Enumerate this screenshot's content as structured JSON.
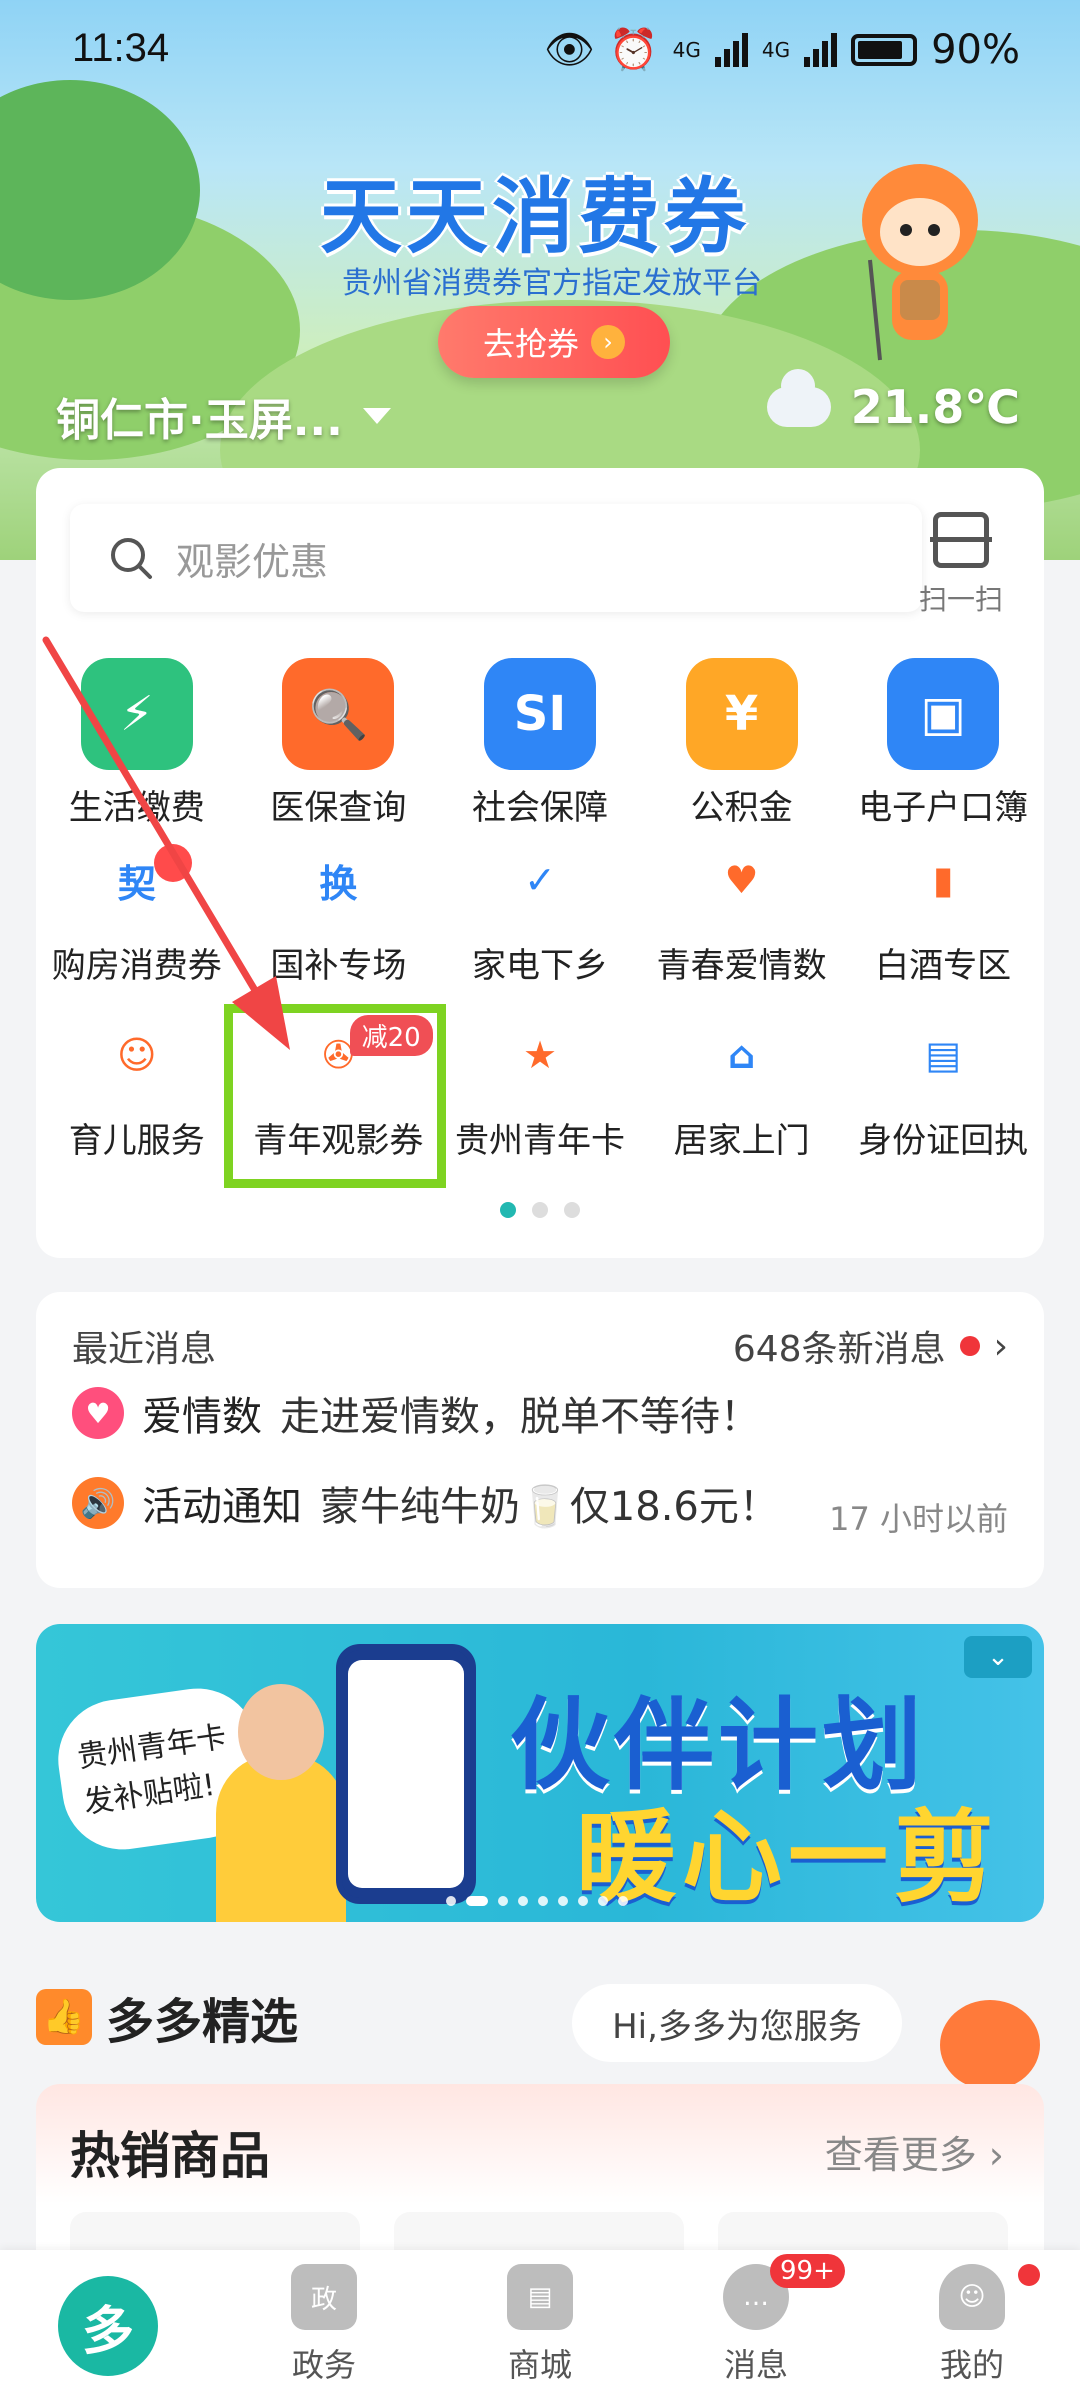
{
  "status_bar": {
    "time": "11:34",
    "battery": "90%",
    "net1": "4G",
    "net2": "4G"
  },
  "header": {
    "banner_title": "天天消费券",
    "banner_subtitle": "贵州省消费券官方指定发放平台",
    "grab_button": "去抢券",
    "location": "铜仁市·玉屏...",
    "temperature": "21.8℃"
  },
  "search": {
    "placeholder": "观影优惠",
    "scan_label": "扫一扫"
  },
  "services": {
    "row1": [
      {
        "label": "生活缴费",
        "icon": "lightning-icon",
        "color": "#2ec27e"
      },
      {
        "label": "医保查询",
        "icon": "search-card-icon",
        "color": "#ff6a2b"
      },
      {
        "label": "社会保障",
        "icon": "si-icon",
        "color": "#2f86f6",
        "icon_text": "SI"
      },
      {
        "label": "公积金",
        "icon": "house-yen-icon",
        "color": "#ffa726",
        "icon_text": "¥"
      },
      {
        "label": "电子户口簿",
        "icon": "id-book-icon",
        "color": "#2f86f6"
      }
    ],
    "row2": [
      {
        "label": "购房消费券",
        "icon": "house-contract-icon",
        "color": "#2f86f6",
        "icon_text": "契"
      },
      {
        "label": "国补专场",
        "icon": "camera-exchange-icon",
        "color": "#2f86f6",
        "icon_text": "换"
      },
      {
        "label": "家电下乡",
        "icon": "house-check-icon",
        "color": "#2f86f6"
      },
      {
        "label": "青春爱情数",
        "icon": "heart-icon",
        "color": "#ff6a2b"
      },
      {
        "label": "白酒专区",
        "icon": "liquor-bottle-icon",
        "color": "#ff6a2b"
      }
    ],
    "row3": [
      {
        "label": "育儿服务",
        "icon": "baby-icon",
        "color": "#ff6a2b"
      },
      {
        "label": "青年观影券",
        "icon": "film-reel-icon",
        "color": "#ff6a2b",
        "tag": "减20"
      },
      {
        "label": "贵州青年卡",
        "icon": "star-card-icon",
        "color": "#ff6a2b"
      },
      {
        "label": "居家上门",
        "icon": "home-heart-icon",
        "color": "#2f86f6"
      },
      {
        "label": "身份证回执",
        "icon": "id-card-icon",
        "color": "#2f86f6"
      }
    ]
  },
  "messages": {
    "header": "最近消息",
    "count_text": "648条新消息",
    "items": [
      {
        "source": "爱情数",
        "text": "走进爱情数，脱单不等待！",
        "icon_color": "#ff4f7d"
      },
      {
        "source": "活动通知",
        "text": "蒙牛纯牛奶🥛仅18.6元！",
        "time": "17 小时以前",
        "icon_color": "#ff7a2b"
      }
    ]
  },
  "promo_banner": {
    "line1": "伙伴计划",
    "line2": "暖心一剪",
    "bubble": "贵州青年卡 发补贴啦!"
  },
  "picks": {
    "title": "多多精选",
    "helper": "Hi,多多为您服务"
  },
  "hot": {
    "title": "热销商品",
    "more": "查看更多"
  },
  "tabbar": {
    "tabs": [
      {
        "label": "",
        "icon": "home-logo-icon"
      },
      {
        "label": "政务",
        "icon": "government-icon"
      },
      {
        "label": "商城",
        "icon": "shop-icon"
      },
      {
        "label": "消息",
        "icon": "chat-icon",
        "badge": "99+"
      },
      {
        "label": "我的",
        "icon": "user-icon"
      }
    ]
  },
  "colors": {
    "accent": "#1ab8a3",
    "highlight_box": "#7ed321",
    "arrow": "#f04545"
  }
}
